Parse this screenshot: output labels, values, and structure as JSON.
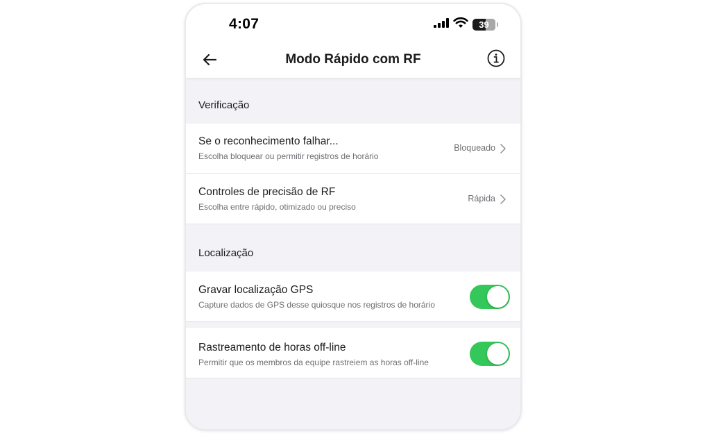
{
  "status_bar": {
    "time": "4:07",
    "battery_level": "39",
    "icons": [
      "cellular-signal-icon",
      "wifi-icon",
      "battery-icon"
    ]
  },
  "nav": {
    "title": "Modo Rápido com RF",
    "back_icon": "arrow-left-icon",
    "info_icon": "info-icon"
  },
  "sections": {
    "verification": {
      "header": "Verificação",
      "rows": [
        {
          "title": "Se o reconhecimento falhar...",
          "subtitle": "Escolha bloquear ou permitir registros de horário",
          "value": "Bloqueado"
        },
        {
          "title": "Controles de precisão de RF",
          "subtitle": "Escolha entre rápido, otimizado ou preciso",
          "value": "Rápida"
        }
      ]
    },
    "location": {
      "header": "Localização",
      "rows": [
        {
          "title": "Gravar localização GPS",
          "subtitle": "Capture dados de GPS desse quiosque nos registros de horário",
          "enabled": true
        },
        {
          "title": "Rastreamento de horas off-line",
          "subtitle": "Permitir que os membros da equipe rastreiem as horas off-line",
          "enabled": true
        }
      ]
    }
  },
  "colors": {
    "toggle_on": "#34c759",
    "background": "#f2f2f7",
    "card": "#ffffff"
  }
}
